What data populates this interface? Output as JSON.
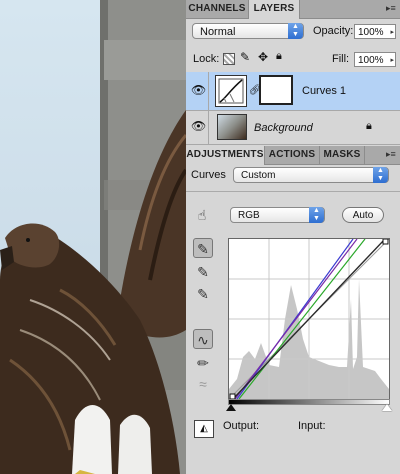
{
  "panels_top": {
    "tabs": [
      "CHANNELS",
      "LAYERS"
    ],
    "blend_mode": "Normal",
    "opacity_label": "Opacity:",
    "opacity_value": "100%",
    "lock_label": "Lock:",
    "fill_label": "Fill:",
    "fill_value": "100%",
    "layers": [
      {
        "name": "Curves 1",
        "selected": true
      },
      {
        "name": "Background",
        "selected": false,
        "locked": true
      }
    ]
  },
  "adjustments": {
    "tabs": [
      "ADJUSTMENTS",
      "ACTIONS",
      "MASKS"
    ],
    "curves_label": "Curves",
    "preset": "Custom",
    "channel": "RGB",
    "auto_label": "Auto",
    "output_label": "Output:",
    "input_label": "Input:"
  },
  "colors": {
    "panel_bg": "#d6d6d6",
    "tab_bar": "#a9a9a9",
    "selected_row": "#b4d2f5",
    "select_arrow": "#2e6ed1",
    "curve_rgb": "#2a2a2a",
    "curve_blue": "#3a3ad0",
    "curve_green": "#2aa82a",
    "curve_purple": "#7a2aa8"
  }
}
